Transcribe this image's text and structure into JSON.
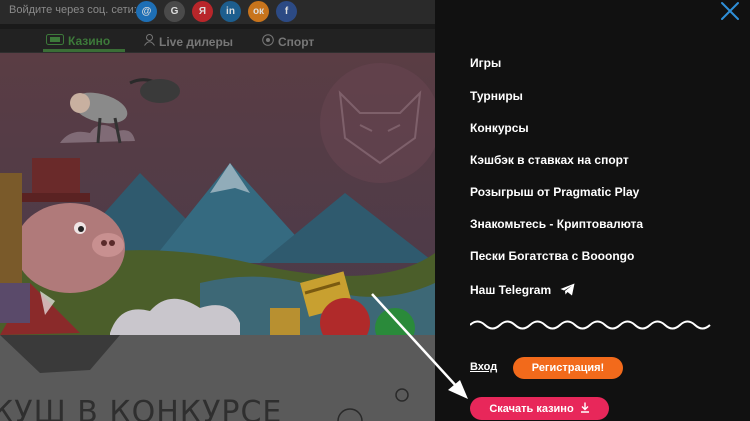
{
  "topbar": {
    "social_label": "Войдите через соц. сети:",
    "socials": [
      {
        "name": "mail-ru",
        "glyph": "@",
        "color": "#1e6fb5"
      },
      {
        "name": "google",
        "glyph": "G",
        "color": "#4a4a4a"
      },
      {
        "name": "yandex",
        "glyph": "Я",
        "color": "#b8262a"
      },
      {
        "name": "linkedin",
        "glyph": "in",
        "color": "#1d5e8e"
      },
      {
        "name": "odnoklassniki",
        "glyph": "ок",
        "color": "#c8741c"
      },
      {
        "name": "facebook",
        "glyph": "f",
        "color": "#2c4a84"
      }
    ]
  },
  "nav": {
    "tabs": [
      {
        "label": "Казино",
        "icon": "casino-icon"
      },
      {
        "label": "Live дилеры",
        "icon": "dealer-icon"
      },
      {
        "label": "Спорт",
        "icon": "ball-icon"
      }
    ]
  },
  "menu": {
    "items": [
      "Игры",
      "Турниры",
      "Конкурсы",
      "Кэшбэк в ставках на спорт",
      "Розыгрыш от Pragmatic Play",
      "Знакомьтесь - Криптовалюта",
      "Пески Богатства с Booongo",
      "Наш Telegram"
    ],
    "login": "Вход",
    "register": "Регистрация!",
    "download": "Скачать казино"
  },
  "colors": {
    "register": "#f26a1b",
    "download": "#e8275a",
    "panel": "#111111"
  },
  "lower": {
    "title_fragment": "куш в конкурсе"
  }
}
